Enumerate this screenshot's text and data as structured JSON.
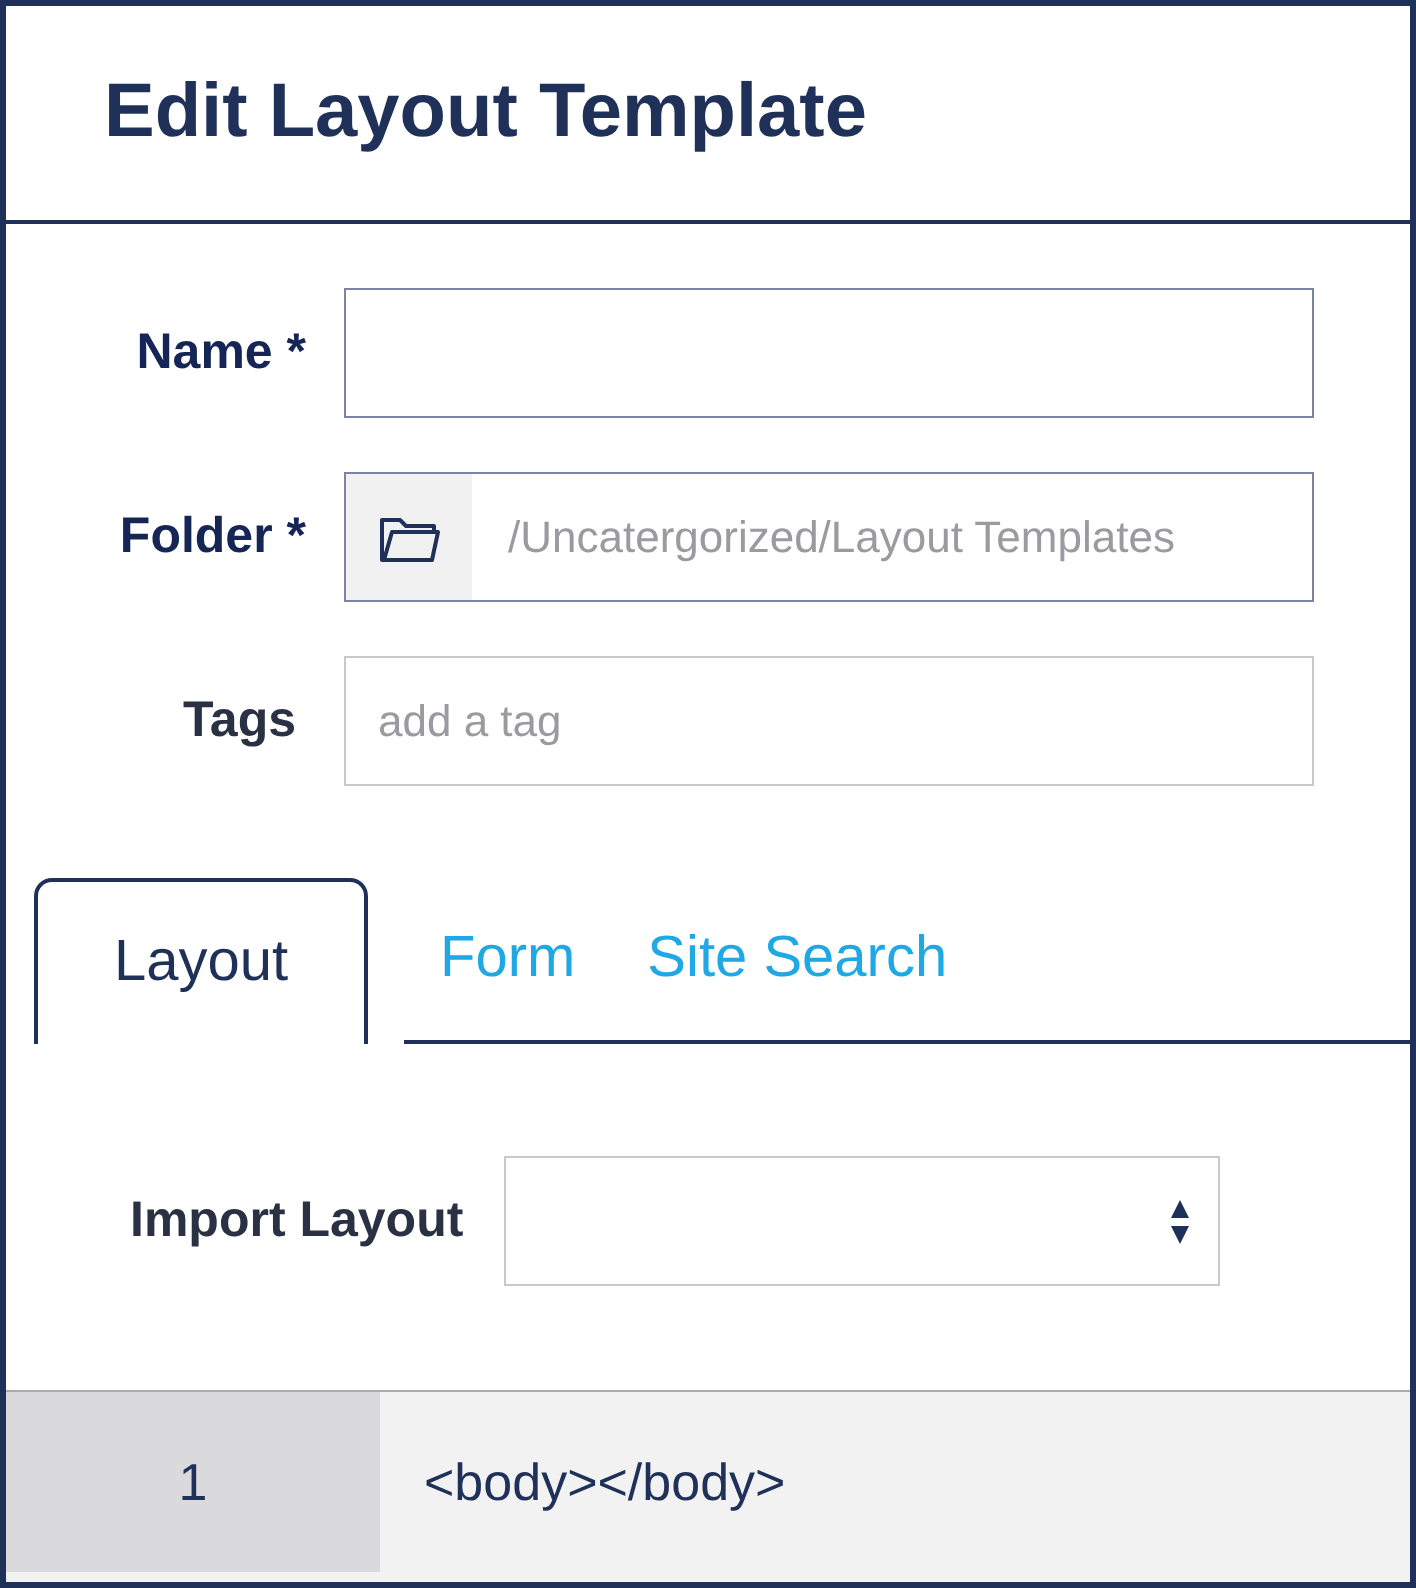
{
  "window": {
    "title": "Edit Layout Template"
  },
  "fields": [
    {
      "kind": "text",
      "label": "Name *",
      "required": true
    },
    {
      "kind": "folder",
      "label": "Folder *",
      "required": true,
      "placeholder": "/Uncatergorized/Layout Templates"
    },
    {
      "kind": "text",
      "label": "Tags",
      "required": false,
      "placeholder": "add a tag"
    }
  ],
  "tabs": [
    {
      "label": "Layout",
      "selected": true
    },
    {
      "label": "Form",
      "selected": false
    },
    {
      "label": "Site Search",
      "selected": false
    }
  ],
  "import_layout": {
    "label": "Import Layout"
  },
  "editor": {
    "lines": [
      {
        "number": "1",
        "code": "<body></body>"
      }
    ]
  }
}
